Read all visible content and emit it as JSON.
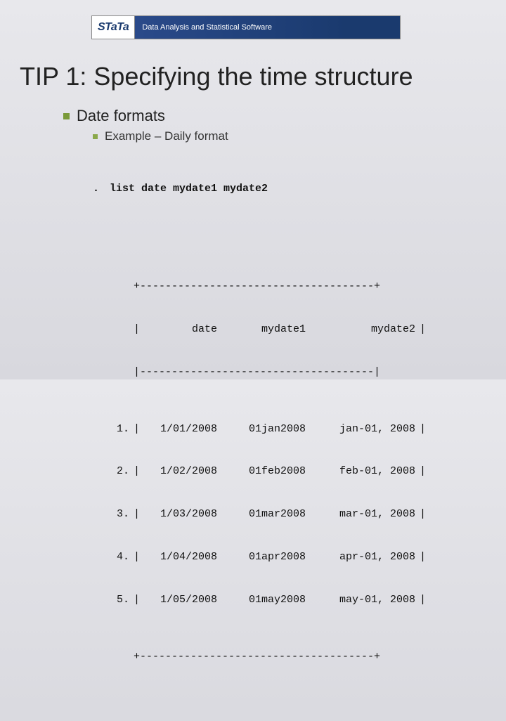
{
  "banner": {
    "logo_text": "STaTa",
    "tagline": "Data Analysis and Statistical Software"
  },
  "title": "TIP 1: Specifying the time structure",
  "bullets": {
    "lvl1": "Date formats",
    "lvl2": "Example – Daily format"
  },
  "command": {
    "prompt": ".",
    "text": "list date mydate1 mydate2"
  },
  "table": {
    "border_top": "+-------------------------------------+",
    "border_mid": "|-------------------------------------|",
    "border_bottom": "+-------------------------------------+",
    "pipe": "|",
    "headers": {
      "date": "date",
      "mydate1": "mydate1",
      "mydate2": "mydate2"
    },
    "rows": [
      {
        "n": "1.",
        "date": "1/01/2008",
        "mydate1": "01jan2008",
        "mydate2": "jan-01, 2008"
      },
      {
        "n": "2.",
        "date": "1/02/2008",
        "mydate1": "01feb2008",
        "mydate2": "feb-01, 2008"
      },
      {
        "n": "3.",
        "date": "1/03/2008",
        "mydate1": "01mar2008",
        "mydate2": "mar-01, 2008"
      },
      {
        "n": "4.",
        "date": "1/04/2008",
        "mydate1": "01apr2008",
        "mydate2": "apr-01, 2008"
      },
      {
        "n": "5.",
        "date": "1/05/2008",
        "mydate1": "01may2008",
        "mydate2": "may-01, 2008"
      }
    ]
  }
}
